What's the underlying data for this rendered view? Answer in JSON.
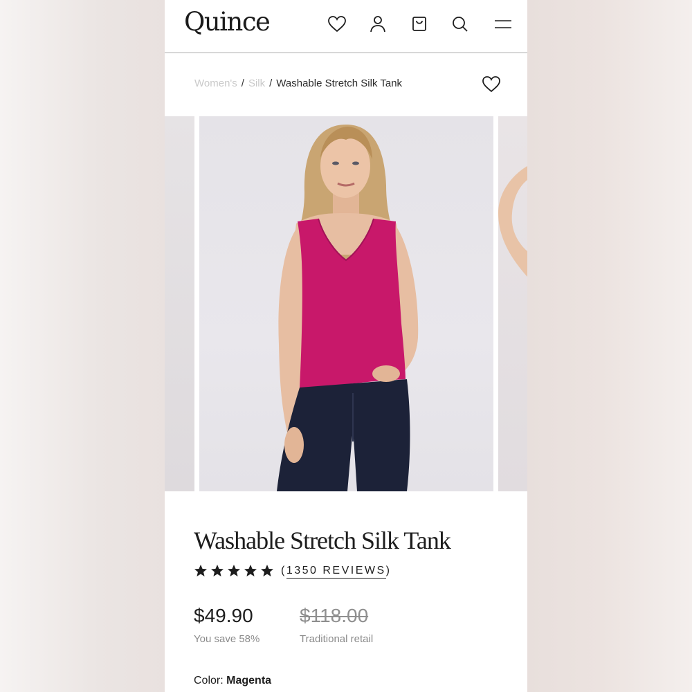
{
  "header": {
    "logo": "Quince",
    "icons": [
      "heart-icon",
      "account-icon",
      "bag-icon",
      "search-icon",
      "menu-icon"
    ]
  },
  "breadcrumb": {
    "items": [
      "Women's",
      "Silk",
      "Washable Stretch Silk Tank"
    ],
    "separator": "/"
  },
  "product": {
    "title": "Washable Stretch Silk Tank",
    "rating_stars": 5,
    "reviews_text": "1350 REVIEWS",
    "reviews_open": "(",
    "reviews_close": ")",
    "price": "$49.90",
    "savings": "You save 58%",
    "retail_price": "$118.00",
    "retail_label": "Traditional retail",
    "color_label": "Color:",
    "color_value": "Magenta"
  },
  "colors": {
    "top": "#c8186a",
    "jeans": "#1c2238",
    "hair": "#c9a572",
    "skin": "#e7bea2",
    "text": "#1d1d1d",
    "muted": "#8a8a8a"
  }
}
